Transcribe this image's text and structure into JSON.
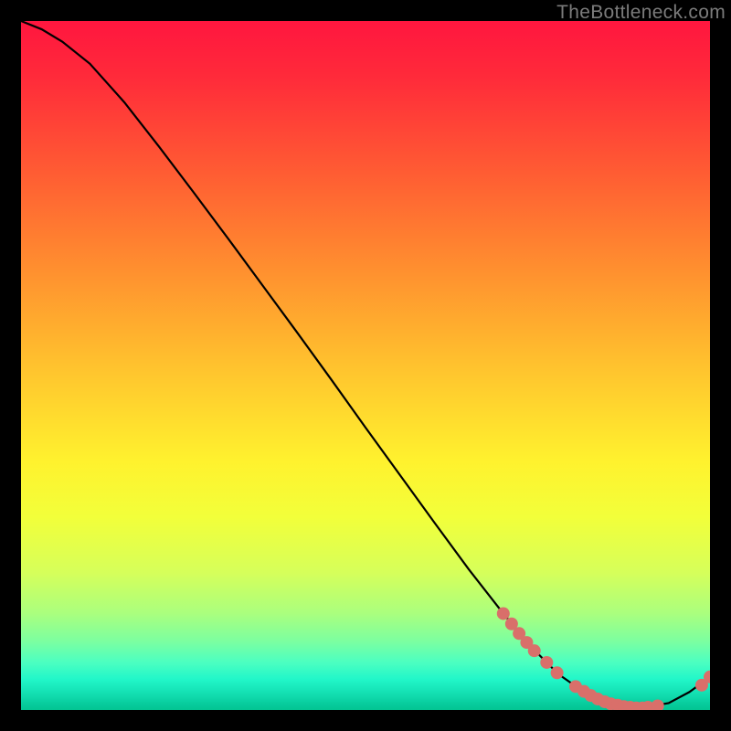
{
  "watermark": "TheBottleneck.com",
  "chart_data": {
    "type": "line",
    "title": "",
    "xlabel": "",
    "ylabel": "",
    "xlim": [
      0,
      100
    ],
    "ylim": [
      0,
      100
    ],
    "grid": false,
    "legend": false,
    "series": [
      {
        "name": "curve",
        "x": [
          0,
          3,
          6,
          10,
          15,
          20,
          25,
          30,
          35,
          40,
          45,
          50,
          55,
          60,
          65,
          70,
          74,
          78,
          82,
          86,
          90,
          94,
          97,
          100
        ],
        "y": [
          100,
          98.8,
          97.0,
          93.8,
          88.2,
          81.8,
          75.2,
          68.5,
          61.7,
          54.9,
          48.0,
          41.0,
          34.1,
          27.2,
          20.4,
          14.0,
          9.2,
          5.2,
          2.4,
          0.8,
          0.3,
          1.0,
          2.6,
          4.8
        ]
      }
    ],
    "markers": [
      {
        "x": 70.0,
        "y": 14.0
      },
      {
        "x": 71.2,
        "y": 12.5
      },
      {
        "x": 72.3,
        "y": 11.1
      },
      {
        "x": 73.4,
        "y": 9.8
      },
      {
        "x": 74.5,
        "y": 8.6
      },
      {
        "x": 76.3,
        "y": 6.9
      },
      {
        "x": 77.8,
        "y": 5.4
      },
      {
        "x": 80.5,
        "y": 3.4
      },
      {
        "x": 81.7,
        "y": 2.7
      },
      {
        "x": 82.7,
        "y": 2.1
      },
      {
        "x": 83.7,
        "y": 1.6
      },
      {
        "x": 84.7,
        "y": 1.2
      },
      {
        "x": 85.6,
        "y": 0.9
      },
      {
        "x": 86.6,
        "y": 0.7
      },
      {
        "x": 87.5,
        "y": 0.5
      },
      {
        "x": 88.4,
        "y": 0.4
      },
      {
        "x": 89.3,
        "y": 0.3
      },
      {
        "x": 90.2,
        "y": 0.3
      },
      {
        "x": 91.0,
        "y": 0.4
      },
      {
        "x": 92.4,
        "y": 0.6
      },
      {
        "x": 98.8,
        "y": 3.6
      },
      {
        "x": 100.0,
        "y": 4.8
      }
    ],
    "marker_color": "#d96f6a",
    "marker_radius": 7,
    "line_color": "#000000",
    "line_width": 2.2
  }
}
